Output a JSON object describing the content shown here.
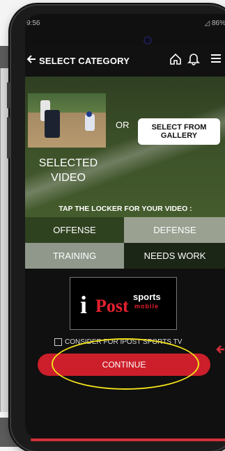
{
  "status_bar": {
    "time": "9:56",
    "battery": "86%"
  },
  "header": {
    "title": "SELECT CATEGORY",
    "icons": [
      "back-arrow-icon",
      "home-icon",
      "bell-icon",
      "menu-icon"
    ]
  },
  "video_select": {
    "selected_label_line1": "SELECTED",
    "selected_label_line2": "VIDEO",
    "or_label": "OR",
    "gallery_line1": "SELECT FROM",
    "gallery_line2": "GALLERY"
  },
  "locker": {
    "prompt": "TAP THE LOCKER FOR YOUR VIDEO :",
    "options": [
      "OFFENSE",
      "DEFENSE",
      "TRAINING",
      "NEEDS WORK"
    ]
  },
  "logo": {
    "i": "i",
    "post": "Post",
    "sports": "sports",
    "mobile": "mobile"
  },
  "consider_label": "CONSIDER FOR IPOST SPORTS TV",
  "continue_label": "CONTINUE",
  "colors": {
    "accent_red": "#cc1f2b",
    "highlight_yellow": "#f2e21a"
  }
}
